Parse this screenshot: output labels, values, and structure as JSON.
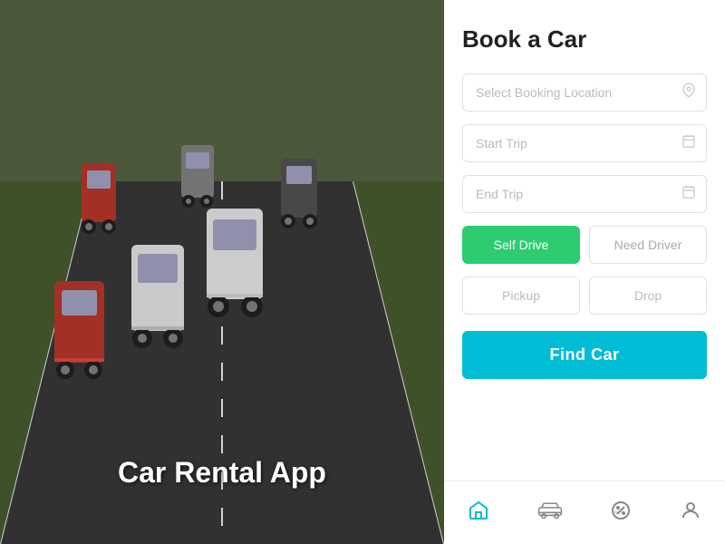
{
  "left": {
    "app_title": "Car Rental App"
  },
  "right": {
    "form_title": "Book a Car",
    "location_placeholder": "Select Booking Location",
    "start_trip_placeholder": "Start Trip",
    "end_trip_placeholder": "End Trip",
    "drive_options": [
      {
        "label": "Self Drive",
        "active": true
      },
      {
        "label": "Need Driver",
        "active": false
      }
    ],
    "location_options": [
      {
        "label": "Pickup"
      },
      {
        "label": "Drop"
      }
    ],
    "find_car_label": "Find Car"
  },
  "bottom_nav": [
    {
      "icon": "home",
      "label": "home",
      "active": true
    },
    {
      "icon": "car",
      "label": "car",
      "active": false
    },
    {
      "icon": "offer",
      "label": "offer",
      "active": false
    },
    {
      "icon": "profile",
      "label": "profile",
      "active": false
    }
  ]
}
